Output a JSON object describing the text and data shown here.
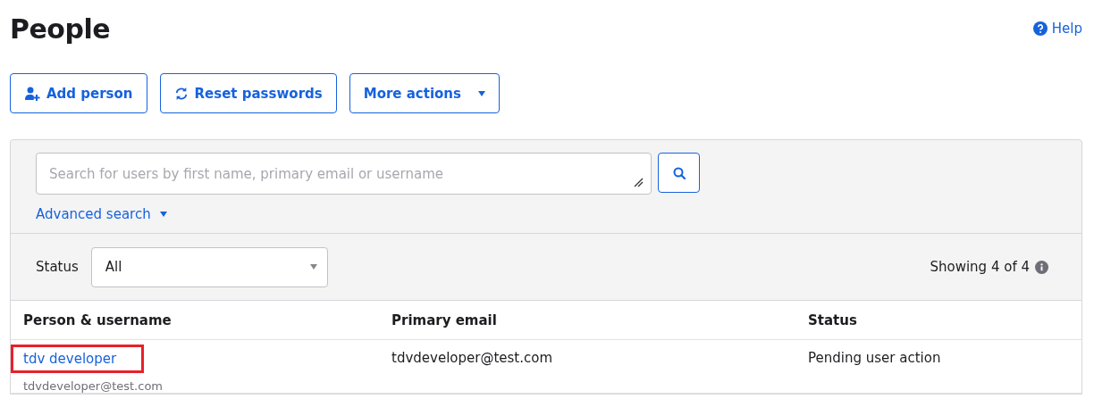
{
  "page": {
    "title": "People",
    "help": "Help"
  },
  "actions": [
    {
      "label": "Add person",
      "kind": "add"
    },
    {
      "label": "Reset passwords",
      "kind": "reset"
    },
    {
      "label": "More actions",
      "kind": "menu"
    }
  ],
  "search": {
    "placeholder": "Search for users by first name, primary email or username",
    "advanced": "Advanced search"
  },
  "filter": {
    "label": "Status",
    "value": "All",
    "count": "Showing 4 of 4"
  },
  "table": {
    "columns": [
      "Person & username",
      "Primary email",
      "Status"
    ],
    "rows": [
      {
        "name": "tdv developer",
        "username": "tdvdeveloper@test.com",
        "email": "tdvdeveloper@test.com",
        "status": "Pending user action",
        "highlighted": true
      }
    ]
  }
}
